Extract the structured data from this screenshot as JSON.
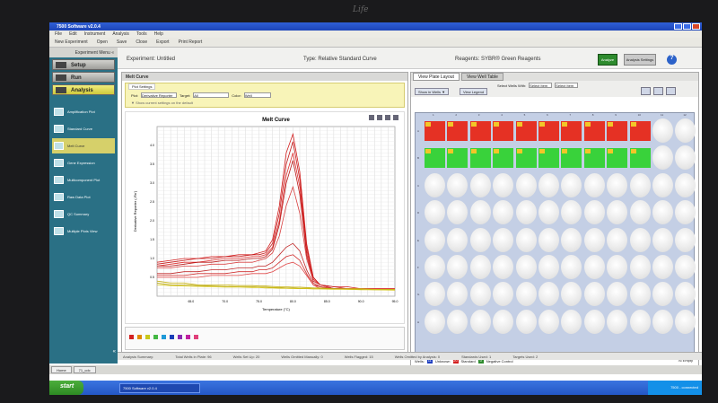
{
  "brand": {
    "logo": "Life"
  },
  "window": {
    "title": "7500 Software v2.0.4"
  },
  "menu": [
    "File",
    "Edit",
    "Instrument",
    "Analysis",
    "Tools",
    "Help"
  ],
  "toolbar": {
    "new": "New Experiment",
    "open": "Open",
    "save": "Save",
    "close": "Close",
    "export": "Export",
    "print": "Print Report"
  },
  "header": {
    "experiment": "Experiment:  Untitled",
    "type": "Type: Relative Standard Curve",
    "reagents": "Reagents: SYBR® Green Reagents",
    "analyze": "Analyze",
    "settings": "Analysis Settings",
    "help": "?"
  },
  "sidebar": {
    "title": "Experiment Menu «",
    "stages": [
      "Setup",
      "Run",
      "Analysis"
    ],
    "items": [
      "Amplification Plot",
      "Standard Curve",
      "Melt Curve",
      "Gene Expression",
      "Multicomponent Plot",
      "Raw Data Plot",
      "QC Summary",
      "Multiple Plots View"
    ],
    "selected_index": 2
  },
  "melt": {
    "panel_title": "Melt Curve",
    "settings_tab": "Plot Settings",
    "plot_label": "Plot:",
    "plot_value": "Derivative Reporter",
    "target_label": "Target:",
    "target_value": "All",
    "color_label": "Color:",
    "color_value": "Well",
    "note": "▼ Show current settings on the default"
  },
  "right": {
    "tabs": [
      "View Plate Layout",
      "View Well Table"
    ],
    "select_label": "Select Wells With:",
    "select1": "Select Item",
    "select2": "Select Item",
    "show_in_wells": "Show in Wells ▼",
    "view_legend": "View Legend",
    "wells_label": "Wells:",
    "unknown": "Unknown",
    "standard": "Standard",
    "ntc": "Negative Control",
    "unknown_count": "11",
    "standard_count": "20",
    "ntc_count": "0",
    "empty_label": "76 Empty",
    "col_headers": [
      "1",
      "2",
      "3",
      "4",
      "5",
      "6",
      "7",
      "8",
      "9",
      "10",
      "11",
      "12"
    ],
    "row_headers": [
      "A",
      "B",
      "C",
      "D",
      "E",
      "F",
      "G",
      "H"
    ]
  },
  "status": {
    "summary": "Analysis Summary:",
    "total": "Total Wells in Plate: 96",
    "setup": "Wells Set Up: 20",
    "omit_manual": "Wells Omitted Manually: 0",
    "flagged": "Wells Flagged: 15",
    "omit_analysis": "Wells Omitted by Analysis: 0",
    "std_used": "Standards Used: 1",
    "targets_used": "Targets Used: 2"
  },
  "bottom_tabs": [
    "Home",
    "71_cdc"
  ],
  "taskbar": {
    "start": "start",
    "app": "7500 Software v2.0.4",
    "tray": "7500 - connected"
  },
  "chart_data": {
    "type": "line",
    "title": "Melt Curve",
    "xlabel": "Temperature (°C)",
    "ylabel": "Derivative Reporter (-Rn')",
    "xlim": [
      60,
      95
    ],
    "ylim": [
      0,
      4.5
    ],
    "xticks": [
      65,
      70,
      75,
      80,
      85,
      90,
      95
    ],
    "yticks": [
      0.5,
      1.0,
      1.5,
      2.0,
      2.5,
      3.0,
      3.5,
      4.0
    ],
    "x": [
      60,
      62,
      64,
      66,
      68,
      70,
      72,
      74,
      75,
      76,
      77,
      78,
      79,
      80,
      81,
      82,
      83,
      84,
      86,
      88,
      90,
      92,
      95
    ],
    "series": [
      {
        "color": "#d32020",
        "values": [
          0.9,
          0.95,
          1.0,
          1.0,
          1.05,
          1.05,
          1.1,
          1.1,
          1.15,
          1.2,
          1.5,
          2.4,
          3.8,
          4.3,
          3.3,
          1.4,
          0.5,
          0.3,
          0.25,
          0.25,
          0.2,
          0.2,
          0.2
        ]
      },
      {
        "color": "#c41a1a",
        "values": [
          0.85,
          0.9,
          0.95,
          1.0,
          1.0,
          1.05,
          1.05,
          1.1,
          1.1,
          1.15,
          1.4,
          2.2,
          3.5,
          4.1,
          3.1,
          1.3,
          0.5,
          0.3,
          0.25,
          0.2,
          0.2,
          0.2,
          0.2
        ]
      },
      {
        "color": "#e03030",
        "values": [
          0.8,
          0.85,
          0.9,
          0.9,
          0.95,
          1.0,
          1.0,
          1.05,
          1.05,
          1.1,
          1.3,
          2.0,
          3.2,
          3.8,
          2.9,
          1.2,
          0.45,
          0.3,
          0.2,
          0.2,
          0.2,
          0.2,
          0.2
        ]
      },
      {
        "color": "#b81818",
        "values": [
          0.8,
          0.8,
          0.85,
          0.9,
          0.9,
          0.95,
          0.95,
          1.0,
          1.0,
          1.05,
          1.25,
          1.9,
          3.0,
          3.6,
          2.7,
          1.1,
          0.4,
          0.3,
          0.2,
          0.2,
          0.2,
          0.2,
          0.2
        ]
      },
      {
        "color": "#d84040",
        "values": [
          0.75,
          0.75,
          0.8,
          0.8,
          0.85,
          0.85,
          0.9,
          0.9,
          0.95,
          1.0,
          1.15,
          1.6,
          2.4,
          2.9,
          2.2,
          1.0,
          0.4,
          0.3,
          0.2,
          0.2,
          0.2,
          0.2,
          0.2
        ]
      },
      {
        "color": "#c02828",
        "values": [
          0.6,
          0.6,
          0.65,
          0.65,
          0.7,
          0.7,
          0.75,
          0.75,
          0.8,
          0.8,
          0.9,
          1.1,
          1.3,
          1.4,
          1.2,
          0.7,
          0.35,
          0.25,
          0.2,
          0.2,
          0.2,
          0.2,
          0.2
        ]
      },
      {
        "color": "#cf2a2a",
        "values": [
          0.55,
          0.55,
          0.55,
          0.6,
          0.6,
          0.6,
          0.65,
          0.65,
          0.7,
          0.7,
          0.75,
          0.9,
          1.05,
          1.1,
          0.95,
          0.6,
          0.3,
          0.25,
          0.2,
          0.2,
          0.2,
          0.2,
          0.2
        ]
      },
      {
        "color": "#e04848",
        "values": [
          0.5,
          0.5,
          0.5,
          0.5,
          0.55,
          0.55,
          0.55,
          0.6,
          0.6,
          0.6,
          0.65,
          0.75,
          0.85,
          0.9,
          0.8,
          0.55,
          0.3,
          0.2,
          0.2,
          0.2,
          0.2,
          0.2,
          0.2
        ]
      },
      {
        "color": "#c8b418",
        "values": [
          0.4,
          0.35,
          0.35,
          0.3,
          0.3,
          0.3,
          0.28,
          0.28,
          0.27,
          0.27,
          0.26,
          0.25,
          0.25,
          0.24,
          0.24,
          0.23,
          0.22,
          0.22,
          0.2,
          0.2,
          0.2,
          0.18,
          0.18
        ]
      },
      {
        "color": "#b8a810",
        "values": [
          0.35,
          0.3,
          0.3,
          0.28,
          0.27,
          0.26,
          0.25,
          0.25,
          0.24,
          0.24,
          0.23,
          0.23,
          0.22,
          0.22,
          0.21,
          0.21,
          0.2,
          0.2,
          0.2,
          0.18,
          0.18,
          0.17,
          0.17
        ]
      },
      {
        "color": "#d8c820",
        "values": [
          0.3,
          0.28,
          0.27,
          0.26,
          0.25,
          0.24,
          0.24,
          0.23,
          0.23,
          0.22,
          0.22,
          0.21,
          0.21,
          0.2,
          0.2,
          0.2,
          0.19,
          0.19,
          0.18,
          0.18,
          0.17,
          0.17,
          0.16
        ]
      }
    ]
  },
  "plate": {
    "row_a": [
      "red",
      "red",
      "red",
      "red",
      "red",
      "red",
      "red",
      "red",
      "red",
      "red",
      "empty",
      "empty"
    ],
    "row_b": [
      "green",
      "green",
      "green",
      "green",
      "green",
      "green",
      "green",
      "green",
      "green",
      "green",
      "empty",
      "empty"
    ]
  },
  "legend_colors": [
    "#d32020",
    "#e08a00",
    "#c8c81a",
    "#44b844",
    "#1f9ad8",
    "#1a3fb8",
    "#8a2ab0",
    "#c020a0",
    "#e0407a"
  ]
}
